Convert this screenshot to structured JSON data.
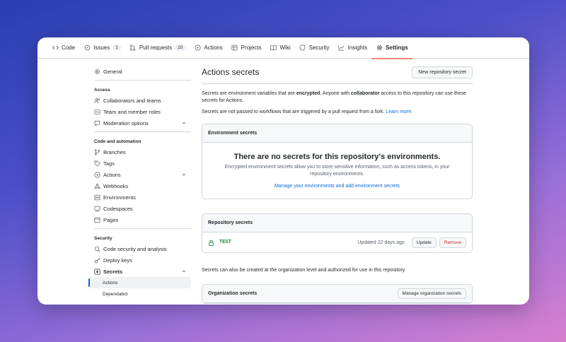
{
  "tabs": [
    {
      "label": "Code",
      "icon": "code-icon"
    },
    {
      "label": "Issues",
      "icon": "issue-icon",
      "count": "1"
    },
    {
      "label": "Pull requests",
      "icon": "pull-request-icon",
      "count": "10"
    },
    {
      "label": "Actions",
      "icon": "play-icon"
    },
    {
      "label": "Projects",
      "icon": "table-icon"
    },
    {
      "label": "Wiki",
      "icon": "book-icon"
    },
    {
      "label": "Security",
      "icon": "shield-icon"
    },
    {
      "label": "Insights",
      "icon": "graph-icon"
    },
    {
      "label": "Settings",
      "icon": "gear-icon",
      "active": true
    }
  ],
  "sidebar": {
    "general": "General",
    "access_heading": "Access",
    "collaborators": "Collaborators and teams",
    "team_roles": "Team and member roles",
    "moderation": "Moderation options",
    "code_heading": "Code and automation",
    "branches": "Branches",
    "tags": "Tags",
    "actions": "Actions",
    "webhooks": "Webhooks",
    "environments": "Environments",
    "codespaces": "Codespaces",
    "pages": "Pages",
    "security_heading": "Security",
    "code_security": "Code security and analysis",
    "deploy_keys": "Deploy keys",
    "secrets": "Secrets",
    "secrets_actions": "Actions",
    "secrets_dependabot": "Dependabot"
  },
  "main": {
    "title": "Actions secrets",
    "new_secret_button": "New repository secret",
    "intro_1": "Secrets are environment variables that are ",
    "intro_bold_1": "encrypted",
    "intro_2": ". Anyone with ",
    "intro_bold_2": "collaborator",
    "intro_3": " access to this repository can use these secrets for Actions.",
    "intro_fork": "Secrets are not passed to workflows that are triggered by a pull request from a fork. ",
    "learn_more": "Learn more.",
    "env_box": {
      "heading": "Environment secrets",
      "blank_title": "There are no secrets for this repository's environments.",
      "blank_text": "Encrypted environment secrets allow you to store sensitive information, such as access tokens, in your repository environments.",
      "manage_link": "Manage your environments and add environment secrets"
    },
    "repo_box": {
      "heading": "Repository secrets",
      "secret_name": "TEST",
      "updated": "Updated 22 days ago",
      "update_button": "Update",
      "remove_button": "Remove"
    },
    "org_note": "Secrets can also be created at the organization level and authorized for use in this repository.",
    "org_box": {
      "heading": "Organization secrets",
      "manage_button": "Manage organization secrets"
    }
  },
  "colors": {
    "accent_tab_underline": "#fd8c73",
    "link": "#0969da",
    "secret_name": "#1a7f37",
    "danger": "#cf222e"
  }
}
